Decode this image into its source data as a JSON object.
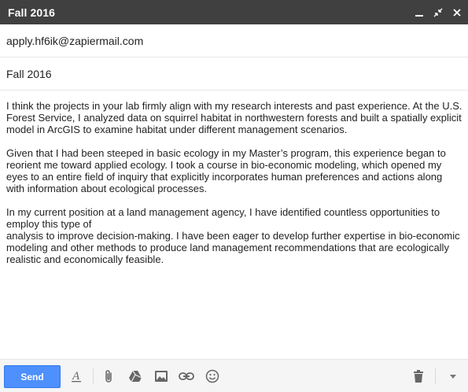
{
  "window": {
    "title": "Fall 2016",
    "controls": [
      "minimize-icon",
      "pop-out-icon",
      "close-icon"
    ]
  },
  "compose": {
    "to": "apply.hf6ik@zapiermail.com",
    "subject": "Fall 2016",
    "body": [
      "I think the projects in your lab firmly align with my research interests and past experience. At the U.S. Forest Service, I analyzed data on squirrel habitat in northwestern forests and built a spatially explicit model in ArcGIS to examine habitat under different management scenarios.",
      "Given that I had been steeped in basic ecology in my Master’s program, this experience began to reorient me toward applied ecology. I took a course in bio-economic modeling, which opened my eyes to an entire field of inquiry that explicitly incorporates human preferences and actions along with information about ecological processes.",
      "In my current position at a land management agency, I have identified countless opportunities to\nemploy this type of\nanalysis to improve decision-making. I have been eager to develop further expertise in bio-economic modeling and other methods to produce land management recommendations that are ecologically realistic and economically feasible."
    ]
  },
  "toolbar": {
    "send_label": "Send",
    "icons": [
      "formatting-icon",
      "attach-icon",
      "drive-icon",
      "photo-icon",
      "link-icon",
      "emoji-icon",
      "trash-icon",
      "more-options-icon"
    ],
    "send_color": "#4d90fe",
    "titlebar_color": "#404040"
  }
}
